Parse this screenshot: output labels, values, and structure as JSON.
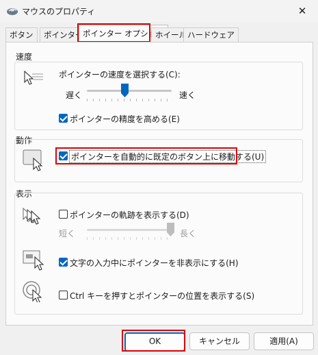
{
  "window": {
    "title": "マウスのプロパティ",
    "close_glyph": "✕"
  },
  "tabs": [
    {
      "label": "ボタン"
    },
    {
      "label": "ポインター"
    },
    {
      "label": "ポインター オプション"
    },
    {
      "label": "ホイール"
    },
    {
      "label": "ハードウェア"
    }
  ],
  "motion": {
    "group_label": "速度",
    "select_label": "ポインターの速度を選択する(C):",
    "slow": "遅く",
    "fast": "速く",
    "speed_level": 0.45,
    "precision_label": "ポインターの精度を高める(E)",
    "precision_checked": true
  },
  "snap": {
    "group_label": "動作",
    "label": "ポインターを自動的に既定のボタン上に移動する(U)",
    "checked": true
  },
  "visibility": {
    "group_label": "表示",
    "trails_label": "ポインターの軌跡を表示する(D)",
    "trails_checked": false,
    "short": "短く",
    "long": "長く",
    "trail_level": 1.0,
    "hide_label": "文字の入力中にポインターを非表示にする(H)",
    "hide_checked": true,
    "ctrl_label": "Ctrl キーを押すとポインターの位置を表示する(S)",
    "ctrl_checked": false
  },
  "buttons": {
    "ok": "OK",
    "cancel": "キャンセル",
    "apply": "適用(A)"
  },
  "colors": {
    "accent": "#0067c0",
    "highlight": "#e00000"
  }
}
